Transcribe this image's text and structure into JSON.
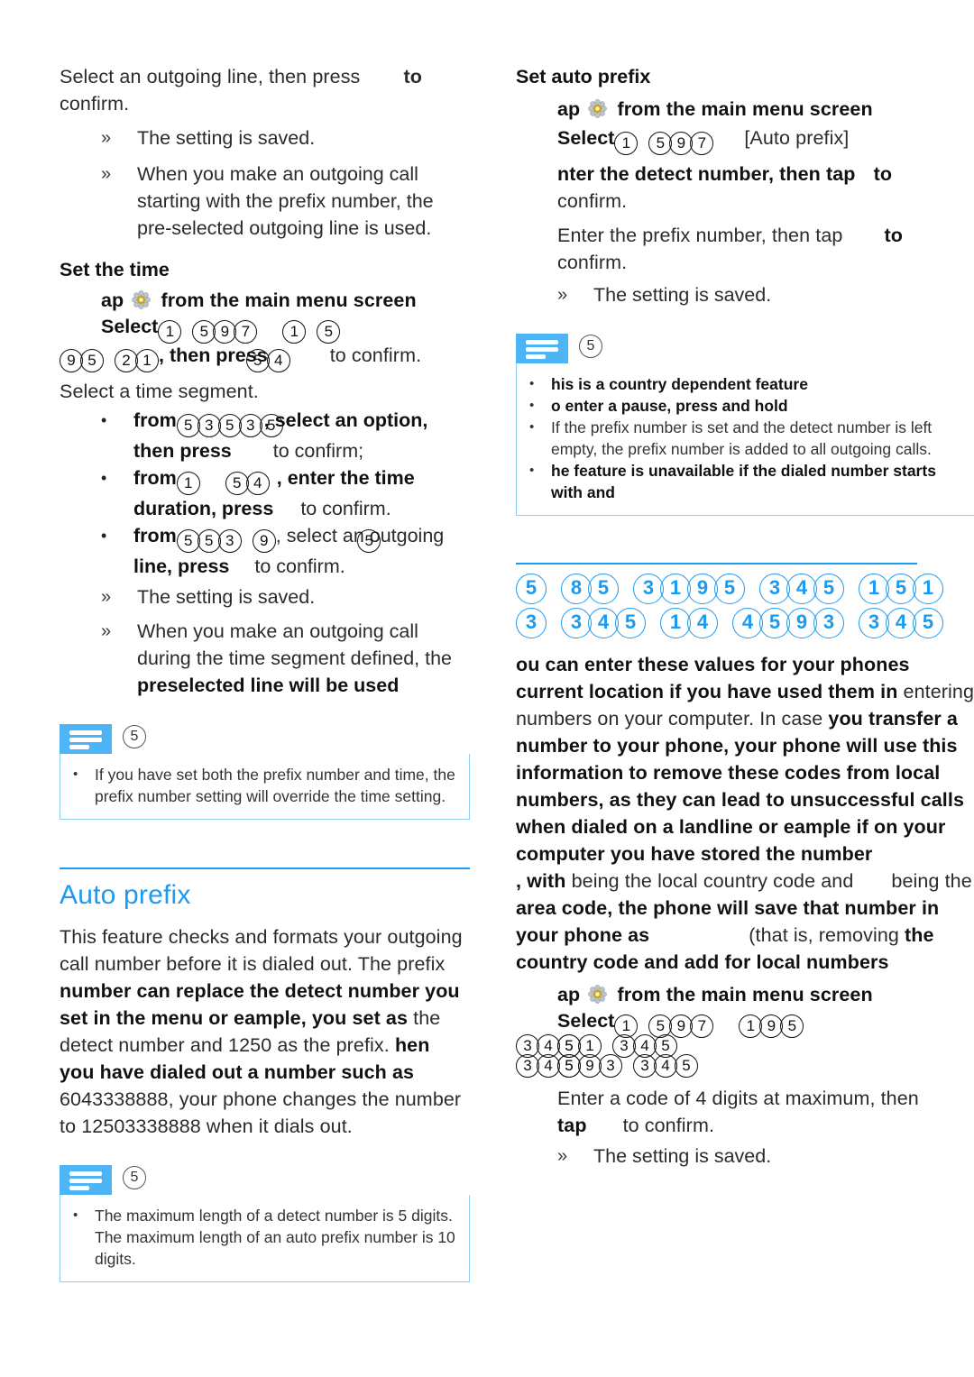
{
  "meta": {
    "doc_kind": "product-manual-page",
    "accent_blue": "#1b9bf0",
    "note_icon_blue": "#4db5f5",
    "note_border_blue": "#8ecdf7"
  },
  "left_column": {
    "intro": {
      "line1_a": "Select an outgoing line, then press",
      "line1_b": "to",
      "line2": "confirm.",
      "results": [
        {
          "guillemet": "»",
          "text": "The setting is saved."
        },
        {
          "guillemet": "»",
          "text": "When you make an outgoing call starting with the prefix number, the pre-selected outgoing line is used."
        }
      ]
    },
    "set_time": {
      "heading": "Set the time",
      "tap_line_a": "ap",
      "gear_icon": "gear-icon",
      "tap_line_b": "from the main menu screen",
      "select_label": "Select",
      "select_digits_row1": [
        "1",
        "5",
        "9",
        "7",
        "1",
        "5"
      ],
      "select_digits_row2": [
        "9",
        "5",
        "2",
        "1",
        "5",
        "4"
      ],
      "then_press": ", then press",
      "to_confirm": "to confirm.",
      "subtitle": "Select a time segment.",
      "bullets": [
        {
          "bullet": "•",
          "lead": "from",
          "digits": [
            "5",
            "3",
            "5",
            "3",
            "5"
          ],
          "mid": ", select an option,",
          "line2_bold": "then press",
          "line2_rest": "to confirm;"
        },
        {
          "bullet": "•",
          "lead": "from",
          "digits": [
            "1",
            "5",
            "4"
          ],
          "mid": ", enter the time",
          "line2_bold": "duration, press",
          "line2_rest": "to confirm."
        },
        {
          "bullet": "•",
          "lead": "from",
          "digits": [
            "5",
            "5",
            "3",
            "9",
            "5"
          ],
          "mid": ", select an outgoing",
          "line2_bold": "line, press",
          "line2_rest": "to confirm."
        }
      ],
      "results": [
        {
          "guillemet": "»",
          "text": "The setting is saved."
        },
        {
          "guillemet": "»",
          "text_plain": "When you make an outgoing call during the time segment defined, the",
          "text_bold": "preselected line will be used"
        }
      ]
    },
    "note_1": {
      "icon": "note-lines-icon",
      "number": "5",
      "items": [
        {
          "bullet": "•",
          "text": "If you have set both the prefix number and time, the prefix number setting will override the time setting.",
          "bold": false
        }
      ]
    },
    "auto_prefix": {
      "heading": "Auto prefix",
      "para_1_plain_a": "This feature checks and formats your outgoing call number before it is dialed out. The prefix",
      "para_1_bold_a": "number can replace the detect number you set in the menu or eample, you set  as",
      "para_1_plain_b": "the detect number and 1250 as the prefix.",
      "para_1_bold_b": "hen you have dialed out a number such as",
      "para_1_plain_c": "6043338888, your phone changes the number to 12503338888 when it dials out."
    },
    "note_2": {
      "icon": "note-lines-icon",
      "number": "5",
      "items": [
        {
          "bullet": "•",
          "text": "The maximum length of a detect number is 5 digits. The maximum length of an auto prefix number is 10 digits.",
          "bold": false
        }
      ]
    }
  },
  "right_column": {
    "set_auto_prefix": {
      "heading": "Set auto prefix",
      "tap_line_a": "ap",
      "gear_icon": "gear-icon",
      "tap_line_b": "from the main menu screen",
      "select_label": "Select",
      "select_digits": [
        "1",
        "5",
        "9",
        "7"
      ],
      "select_bracket": "[Auto prefix]",
      "enter_detect_bold": "nter the detect number, then tap",
      "enter_detect_bold_tail": "to",
      "enter_detect_plain": "confirm.",
      "enter_prefix_plain_a": "Enter the prefix number, then tap",
      "enter_prefix_bold": "to",
      "enter_prefix_plain_b": "confirm.",
      "results": [
        {
          "guillemet": "»",
          "text": "The setting is saved."
        }
      ]
    },
    "note_3": {
      "icon": "note-lines-icon",
      "number": "5",
      "items": [
        {
          "bullet": "•",
          "text": "his is a country dependent feature",
          "bold": true
        },
        {
          "bullet": "•",
          "text": "o enter a pause, press and hold",
          "bold": true
        },
        {
          "bullet": "•",
          "text": "If the prefix number is set and the detect number is left empty, the prefix number is added to all outgoing calls.",
          "bold": false
        },
        {
          "bullet": "•",
          "text": "he feature is unavailable if the dialed number starts with  and",
          "bold": true
        }
      ]
    },
    "blue_heading": {
      "row1": [
        "5",
        "8",
        "5",
        "3",
        "1",
        "9",
        "5",
        "3",
        "4",
        "5",
        "1",
        "5",
        "1"
      ],
      "row2": [
        "3",
        "3",
        "4",
        "5",
        "1",
        "4",
        "4",
        "5",
        "9",
        "3",
        "3",
        "4",
        "5"
      ]
    },
    "country_codes": {
      "l1_bold": "ou can enter these values for your phones current location if you have used them in",
      "l2_plain": "entering numbers on your computer. In case",
      "l3_bold": "you transfer a number to your phone, your phone will use this information to remove these codes from local numbers, as they can lead to unsuccessful calls when dialed on a landline",
      "l4_bold": "or eample if on your computer you have stored the number",
      "l4_bold_tail": ", with",
      "l5_plain": "being the local country code and",
      "l5_plain_tail": "being the",
      "l6_bold": "area code, the phone will save that number in your phone as",
      "l6_plain_tail": "(that is, removing",
      "l7_bold": "the country code and add  for local numbers"
    },
    "set_codes": {
      "tap_line_a": "ap",
      "gear_icon": "gear-icon",
      "tap_line_b": "from the main menu screen",
      "select_label": "Select",
      "select_digits_row1": [
        "1",
        "5",
        "9",
        "7",
        "1",
        "9",
        "5"
      ],
      "select_digits_row2": [
        "3",
        "4",
        "5",
        "1",
        "3",
        "4",
        "5"
      ],
      "select_digits_row3": [
        "3",
        "4",
        "5",
        "9",
        "3",
        "3",
        "4",
        "5"
      ],
      "enter_code": "Enter a code of 4 digits at maximum, then",
      "tap_bold": "tap",
      "tap_rest": "to confirm.",
      "results": [
        {
          "guillemet": "»",
          "text": "The setting is saved."
        }
      ]
    }
  }
}
